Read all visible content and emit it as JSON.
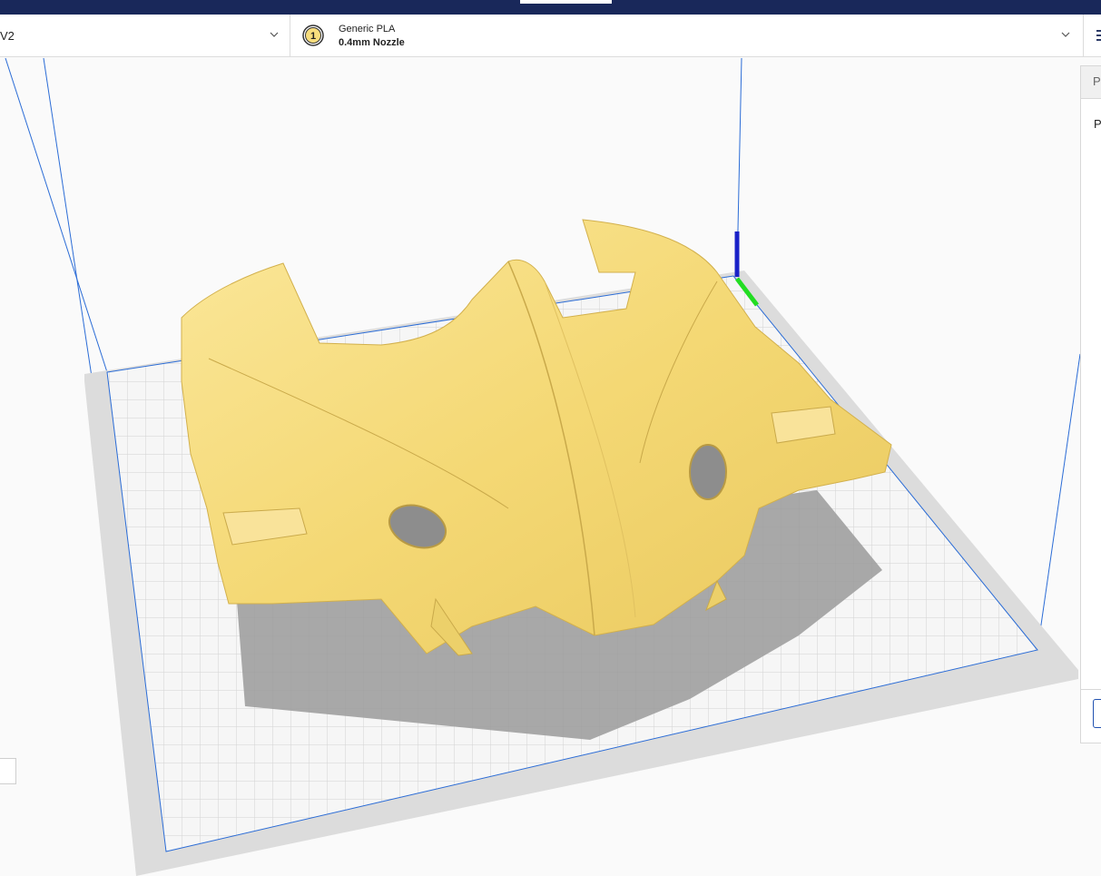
{
  "window": {
    "title_bar_color": "#19285a"
  },
  "toolbar": {
    "printer_name": "V2",
    "extruder": {
      "index": "1",
      "material": "Generic PLA",
      "nozzle": "0.4mm Nozzle"
    }
  },
  "side_panel": {
    "tab_label": "Pr",
    "first_line": "P"
  },
  "icons": {
    "printer_dropdown": "chevron-down-icon",
    "extruder_dropdown": "chevron-down-icon",
    "panel_menu": "hamburger-menu-icon",
    "extruder_badge": "extruder-number-icon"
  },
  "colors": {
    "model": "#f7dd7d",
    "build_plate": "#dcdcdc",
    "volume_outline": "#2b6cd6",
    "accent": "#2051b0"
  }
}
